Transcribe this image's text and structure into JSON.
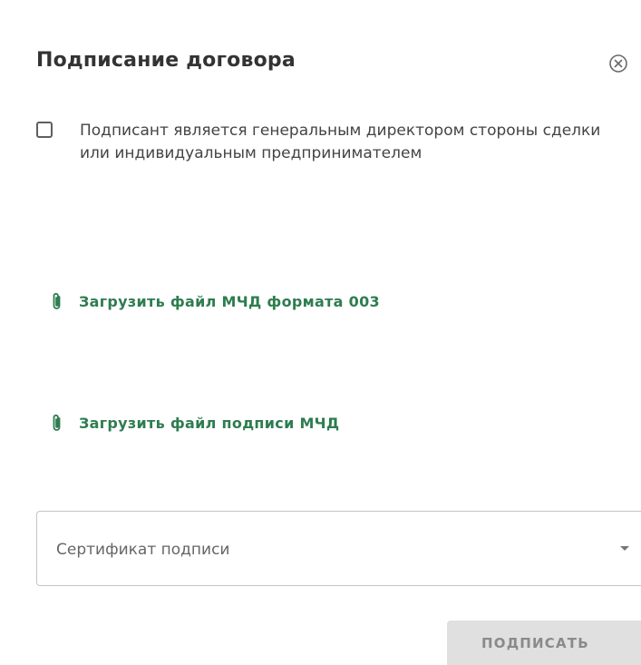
{
  "dialog": {
    "title": "Подписание договора",
    "close_icon": "close-circle-icon"
  },
  "checkbox": {
    "checked": false,
    "label": "Подписант является генеральным директором стороны сделки или индивидуальным предпринимателем"
  },
  "uploads": [
    {
      "icon": "paperclip-icon",
      "label": "Загрузить файл МЧД формата 003"
    },
    {
      "icon": "paperclip-icon",
      "label": "Загрузить файл подписи МЧД"
    }
  ],
  "certificate_select": {
    "placeholder": "Сертификат подписи",
    "icon": "caret-down-icon"
  },
  "sign_button": {
    "label": "ПОДПИСАТЬ",
    "disabled": true
  },
  "colors": {
    "accent_green": "#2e7d4f",
    "text": "#333333",
    "button_bg": "#e0e0e0"
  }
}
